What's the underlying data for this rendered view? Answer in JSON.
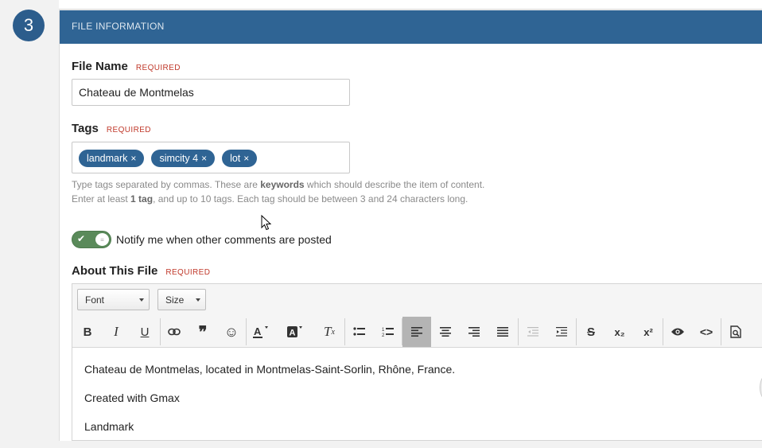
{
  "step": {
    "number": "3"
  },
  "section": {
    "title": "FILE INFORMATION"
  },
  "file_name": {
    "label": "File Name",
    "required": "REQUIRED",
    "value": "Chateau de Montmelas"
  },
  "tags": {
    "label": "Tags",
    "required": "REQUIRED",
    "items": [
      {
        "text": "landmark",
        "remove": "×"
      },
      {
        "text": "simcity 4",
        "remove": "×"
      },
      {
        "text": "lot",
        "remove": "×"
      }
    ],
    "help": {
      "l1_a": "Type tags separated by commas. These are ",
      "l1_b": "keywords",
      "l1_c": " which should describe the item of content.",
      "l2_a": "Enter at least ",
      "l2_b": "1 tag",
      "l2_c": ", and up to 10 tags. Each tag should be between 3 and 24 characters long."
    }
  },
  "notify": {
    "label": "Notify me when other comments are posted",
    "enabled": true
  },
  "about": {
    "label": "About This File",
    "required": "REQUIRED",
    "toolbar": {
      "font": "Font",
      "size": "Size",
      "bold": "B",
      "italic": "I",
      "underline": "U",
      "quote": "❞",
      "emoji": "☺",
      "clear": "T",
      "strike": "S",
      "subscript": "x₂",
      "superscript": "x²",
      "source": "<>"
    },
    "content": [
      "Chateau de Montmelas, located in Montmelas-Saint-Sorlin, Rhône, France.",
      "Created with Gmax",
      "Landmark"
    ]
  },
  "colors": {
    "header": "#2f6494",
    "tag": "#2f6494",
    "toggle": "#5a8a5a",
    "required": "#c0392b"
  }
}
